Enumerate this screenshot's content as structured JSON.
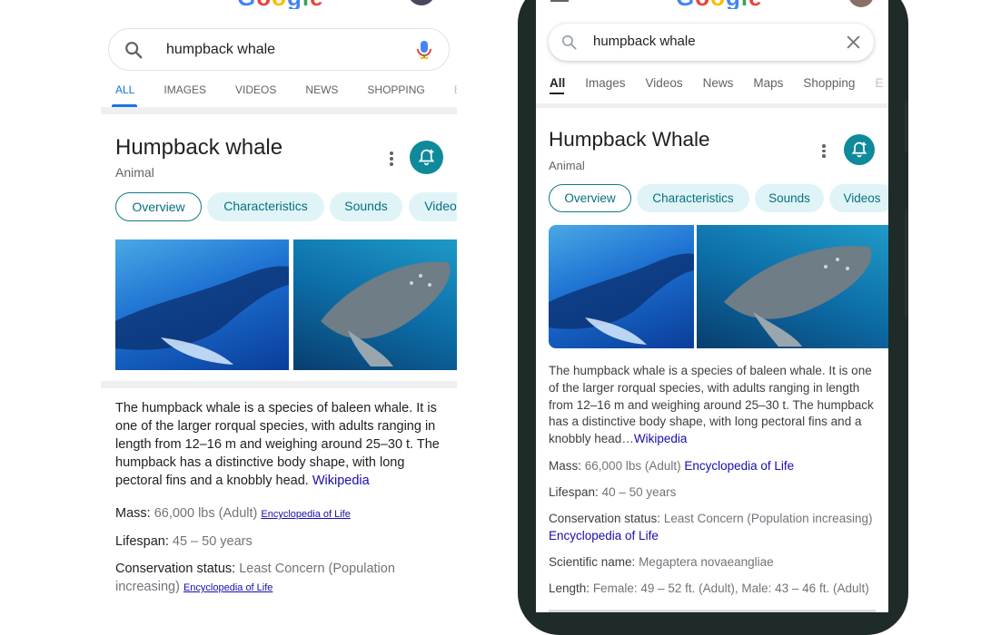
{
  "left": {
    "search": {
      "query": "humpback whale"
    },
    "tabs": [
      "ALL",
      "IMAGES",
      "VIDEOS",
      "NEWS",
      "SHOPPING",
      "BO"
    ],
    "active_tab": "ALL",
    "title": "Humpback whale",
    "subtitle": "Animal",
    "chips": [
      "Overview",
      "Characteristics",
      "Sounds",
      "Video"
    ],
    "description": "The humpback whale is a species of baleen whale. It is one of the larger rorqual species, with adults ranging in length from 12–16 m and weighing around 25–30 t. The humpback has a distinctive body shape, with long pectoral fins and a knobbly head.",
    "description_source": "Wikipedia",
    "facts": {
      "mass_label": "Mass:",
      "mass_value": "66,000 lbs (Adult)",
      "mass_source": "Encyclopedia of Life",
      "lifespan_label": "Lifespan:",
      "lifespan_value": "45 – 50 years",
      "conservation_label": "Conservation status:",
      "conservation_value_1": "Least Concern (Population",
      "conservation_value_2": "increasing)",
      "conservation_source": "Encyclopedia of Life"
    }
  },
  "right": {
    "search": {
      "query": "humpback whale"
    },
    "tabs": [
      "All",
      "Images",
      "Videos",
      "News",
      "Maps",
      "Shopping",
      "E"
    ],
    "active_tab": "All",
    "title": "Humpback Whale",
    "subtitle": "Animal",
    "chips": [
      "Overview",
      "Characteristics",
      "Sounds",
      "Videos"
    ],
    "description": "The humpback whale is a species of baleen whale. It is one of the larger rorqual species, with adults ranging in length from 12–16 m and weighing around 25–30 t. The humpback has a distinctive body shape, with long pectoral fins and a knobbly head…",
    "description_source": "Wikipedia",
    "facts": {
      "mass_label": "Mass:",
      "mass_value": "66,000 lbs (Adult)",
      "mass_source": "Encyclopedia of Life",
      "lifespan_label": "Lifespan:",
      "lifespan_value": "40 – 50 years",
      "conservation_label": "Conservation status:",
      "conservation_value": "Least Concern (Population increasing)",
      "conservation_source": "Encyclopedia of Life",
      "scientific_label": "Scientific name:",
      "scientific_value": "Megaptera novaeangliae",
      "length_label": "Length:",
      "length_value": "Female: 49 – 52 ft. (Adult), Male: 43 – 46 ft. (Adult)"
    }
  },
  "colors": {
    "accent_teal": "#0e8a9b",
    "chip_bg": "#e0f4f8",
    "link": "#1a0dab",
    "active_tab_blue": "#1a73e8"
  }
}
